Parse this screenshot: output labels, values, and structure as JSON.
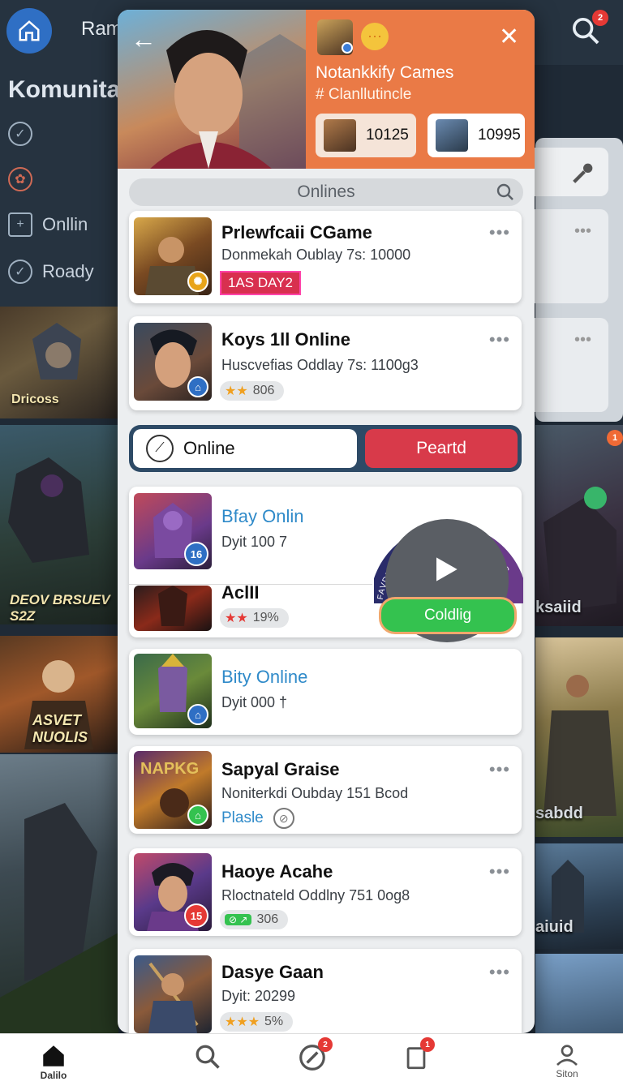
{
  "background": {
    "app_title": "Ram",
    "heading": "Komunita",
    "side_items": [
      {
        "label": "",
        "icon": "check-circle-icon"
      },
      {
        "label": "",
        "icon": "flower-icon"
      },
      {
        "label": "Onllin",
        "icon": "plus-square-icon"
      },
      {
        "label": "Roady",
        "icon": "check-circle-icon"
      }
    ],
    "notification_count": "2",
    "tiles": [
      {
        "caption": "Dricoss"
      },
      {
        "caption": "DEOV BRSUEV S2Z"
      },
      {
        "caption": "ASVET NUOLIS"
      }
    ],
    "right_captions": [
      "ksaiid",
      "sabdd",
      "aiuid"
    ],
    "right_badge": "1"
  },
  "modal": {
    "back_icon": "arrow-left-icon",
    "close_icon": "close-icon",
    "title": "Notankkify Cames",
    "subtitle": "# Clanllutincle",
    "stats": [
      {
        "value": "10125"
      },
      {
        "value": "10995"
      }
    ],
    "search_label": "Onlines",
    "games": [
      {
        "title": "Prlewfcaii CGame",
        "subtitle": "Donmekah Oublay 7s: 10000",
        "tag": "1AS DAY2",
        "more": "•••"
      },
      {
        "title": "Koys 1ll Online",
        "subtitle": "Huscvefias Oddlay 7s: 1100g3",
        "rating": "806",
        "more": "•••"
      },
      {
        "title": "Bfay Onlin",
        "subtitle": "Dyit 100 7",
        "badge": "16"
      },
      {
        "title": "AclII",
        "rating": "19%"
      },
      {
        "title": "Bity Online",
        "subtitle": "Dyit 000 †"
      },
      {
        "title": "Sapyal Graise",
        "subtitle": "Noniterkdi Oubday 151 Bcod",
        "link": "Plasle",
        "more": "•••"
      },
      {
        "title": "Haoye Acahe",
        "subtitle": "Rloctnateld Oddlny 751 0og8",
        "badge": "15",
        "rating": "306",
        "more": "•••"
      },
      {
        "title": "Dasye Gaan",
        "subtitle": "Dyit: 20299",
        "rating": "5%",
        "more": "•••"
      }
    ],
    "toggle": {
      "left": "Online",
      "right": "Peartd"
    },
    "promo": {
      "arc_text": "a FAVDE ON POOTORNERSING STING",
      "button": "Coldlig"
    }
  },
  "nav": {
    "items": [
      {
        "label": "Dalilo",
        "icon": "home-icon"
      },
      {
        "label": "",
        "icon": "search-icon"
      },
      {
        "label": "",
        "icon": "compass-icon",
        "badge": "2"
      },
      {
        "label": "",
        "icon": "bookmark-icon",
        "badge": "1"
      },
      {
        "label": "Siton",
        "icon": "person-icon"
      }
    ]
  },
  "colors": {
    "accent_orange": "#ea7a46",
    "toggle_bg": "#2d4a66",
    "danger": "#d83a4a",
    "success": "#34c24f",
    "link_blue": "#2f8ac9"
  }
}
